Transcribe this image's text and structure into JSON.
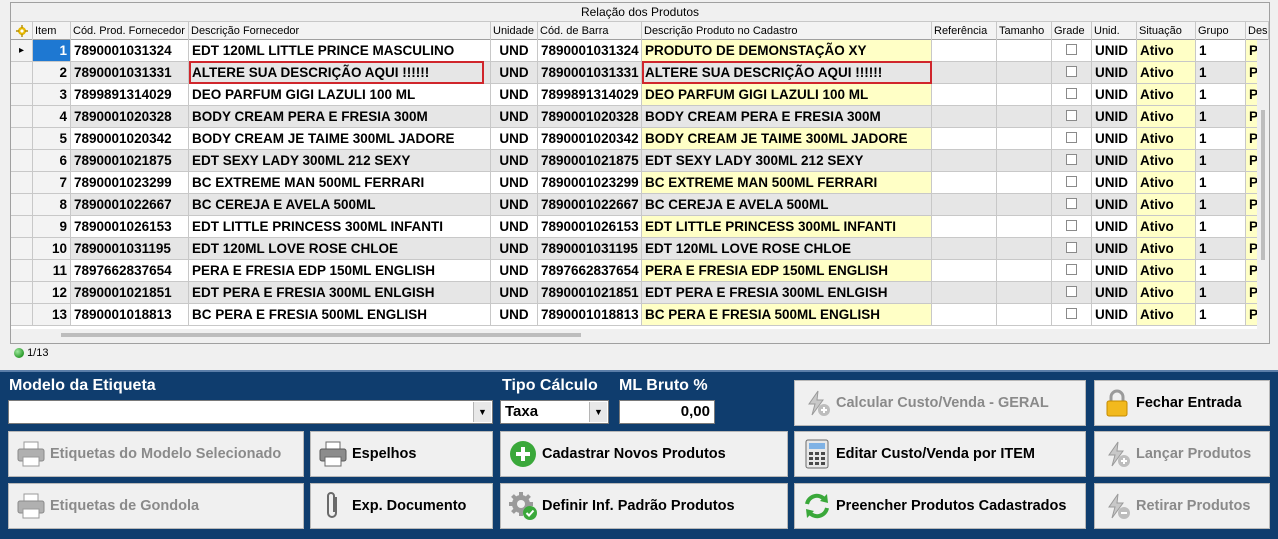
{
  "grid": {
    "title": "Relação dos Produtos",
    "columns": [
      "Item",
      "Cód. Prod. Fornecedor",
      "Descrição Fornecedor",
      "Unidade",
      "Cód. de Barra",
      "Descrição Produto no Cadastro",
      "Referência",
      "Tamanho",
      "Grade",
      "Unid.",
      "Situação",
      "Grupo",
      "Desc."
    ],
    "rows": [
      {
        "item": "1",
        "cod_forn": "7890001031324",
        "desc_forn": "EDT 120ML LITTLE PRINCE MASCULINO",
        "unidade": "UND",
        "cod_barra": "7890001031324",
        "desc_cad": "PRODUTO DE DEMONSTAÇÃO XY",
        "unid": "UNID",
        "situacao": "Ativo",
        "grupo": "1",
        "desc": "PA"
      },
      {
        "item": "2",
        "cod_forn": "7890001031331",
        "desc_forn": "ALTERE SUA DESCRIÇÃO AQUI !!!!!!",
        "unidade": "UND",
        "cod_barra": "7890001031331",
        "desc_cad": "ALTERE SUA DESCRIÇÃO AQUI !!!!!!",
        "unid": "UNID",
        "situacao": "Ativo",
        "grupo": "1",
        "desc": "PA"
      },
      {
        "item": "3",
        "cod_forn": "7899891314029",
        "desc_forn": "DEO PARFUM GIGI LAZULI 100 ML",
        "unidade": "UND",
        "cod_barra": "7899891314029",
        "desc_cad": "DEO PARFUM GIGI LAZULI 100 ML",
        "unid": "UNID",
        "situacao": "Ativo",
        "grupo": "1",
        "desc": "PA"
      },
      {
        "item": "4",
        "cod_forn": "7890001020328",
        "desc_forn": "BODY CREAM PERA E FRESIA 300M",
        "unidade": "UND",
        "cod_barra": "7890001020328",
        "desc_cad": "BODY CREAM PERA E FRESIA 300M",
        "unid": "UNID",
        "situacao": "Ativo",
        "grupo": "1",
        "desc": "PA"
      },
      {
        "item": "5",
        "cod_forn": "7890001020342",
        "desc_forn": "BODY CREAM JE TAIME 300ML JADORE",
        "unidade": "UND",
        "cod_barra": "7890001020342",
        "desc_cad": "BODY CREAM JE TAIME 300ML JADORE",
        "unid": "UNID",
        "situacao": "Ativo",
        "grupo": "1",
        "desc": "PA"
      },
      {
        "item": "6",
        "cod_forn": "7890001021875",
        "desc_forn": "EDT SEXY LADY 300ML 212 SEXY",
        "unidade": "UND",
        "cod_barra": "7890001021875",
        "desc_cad": "EDT SEXY LADY 300ML 212 SEXY",
        "unid": "UNID",
        "situacao": "Ativo",
        "grupo": "1",
        "desc": "PA"
      },
      {
        "item": "7",
        "cod_forn": "7890001023299",
        "desc_forn": "BC EXTREME MAN 500ML FERRARI",
        "unidade": "UND",
        "cod_barra": "7890001023299",
        "desc_cad": "BC EXTREME MAN 500ML FERRARI",
        "unid": "UNID",
        "situacao": "Ativo",
        "grupo": "1",
        "desc": "PA"
      },
      {
        "item": "8",
        "cod_forn": "7890001022667",
        "desc_forn": "BC CEREJA E AVELA 500ML",
        "unidade": "UND",
        "cod_barra": "7890001022667",
        "desc_cad": "BC CEREJA E AVELA 500ML",
        "unid": "UNID",
        "situacao": "Ativo",
        "grupo": "1",
        "desc": "PA"
      },
      {
        "item": "9",
        "cod_forn": "7890001026153",
        "desc_forn": "EDT LITTLE PRINCESS 300ML INFANTI",
        "unidade": "UND",
        "cod_barra": "7890001026153",
        "desc_cad": "EDT LITTLE PRINCESS 300ML INFANTI",
        "unid": "UNID",
        "situacao": "Ativo",
        "grupo": "1",
        "desc": "PA"
      },
      {
        "item": "10",
        "cod_forn": "7890001031195",
        "desc_forn": "EDT 120ML LOVE ROSE CHLOE",
        "unidade": "UND",
        "cod_barra": "7890001031195",
        "desc_cad": "EDT 120ML LOVE ROSE CHLOE",
        "unid": "UNID",
        "situacao": "Ativo",
        "grupo": "1",
        "desc": "PA"
      },
      {
        "item": "11",
        "cod_forn": "7897662837654",
        "desc_forn": "PERA E FRESIA EDP 150ML ENGLISH",
        "unidade": "UND",
        "cod_barra": "7897662837654",
        "desc_cad": "PERA E FRESIA EDP 150ML ENGLISH",
        "unid": "UNID",
        "situacao": "Ativo",
        "grupo": "1",
        "desc": "PA"
      },
      {
        "item": "12",
        "cod_forn": "7890001021851",
        "desc_forn": "EDT PERA E FRESIA 300ML ENLGISH",
        "unidade": "UND",
        "cod_barra": "7890001021851",
        "desc_cad": "EDT PERA E FRESIA 300ML ENLGISH",
        "unid": "UNID",
        "situacao": "Ativo",
        "grupo": "1",
        "desc": "PA"
      },
      {
        "item": "13",
        "cod_forn": "7890001018813",
        "desc_forn": "BC PERA E FRESIA 500ML ENGLISH",
        "unidade": "UND",
        "cod_barra": "7890001018813",
        "desc_cad": "BC PERA E FRESIA 500ML ENGLISH",
        "unid": "UNID",
        "situacao": "Ativo",
        "grupo": "1",
        "desc": "PA"
      }
    ],
    "yellow_rows": [
      1,
      3,
      5,
      7,
      9,
      11,
      13
    ],
    "status": "1/13"
  },
  "form": {
    "modelo_label": "Modelo da Etiqueta",
    "modelo_value": "",
    "tipo_calculo_label": "Tipo Cálculo",
    "tipo_calculo_value": "Taxa",
    "ml_bruto_label": "ML Bruto %",
    "ml_bruto_value": "0,00"
  },
  "buttons": {
    "calcular": "Calcular Custo/Venda - GERAL",
    "fechar": "Fechar Entrada",
    "etiquetas_modelo": "Etiquetas do Modelo Selecionado",
    "espelhos": "Espelhos",
    "cadastrar": "Cadastrar Novos Produtos",
    "editar": "Editar Custo/Venda por ITEM",
    "lancar": "Lançar Produtos",
    "etiquetas_gondola": "Etiquetas de Gondola",
    "exp_documento": "Exp. Documento",
    "definir": "Definir Inf. Padrão Produtos",
    "preencher": "Preencher Produtos Cadastrados",
    "retirar": "Retirar Produtos"
  },
  "colors": {
    "panel": "#0f3d6e",
    "highlight_box": "#d0262c",
    "yellow_cell": "#ffffc6",
    "active_item": "#1e78d2"
  },
  "icons": [
    "asterisk-icon",
    "printer-icon",
    "plus-circle-icon",
    "calculator-icon",
    "lock-icon",
    "lightning-plus-icon",
    "lightning-minus-icon",
    "paperclip-icon",
    "gear-check-icon",
    "refresh-arrows-icon"
  ]
}
